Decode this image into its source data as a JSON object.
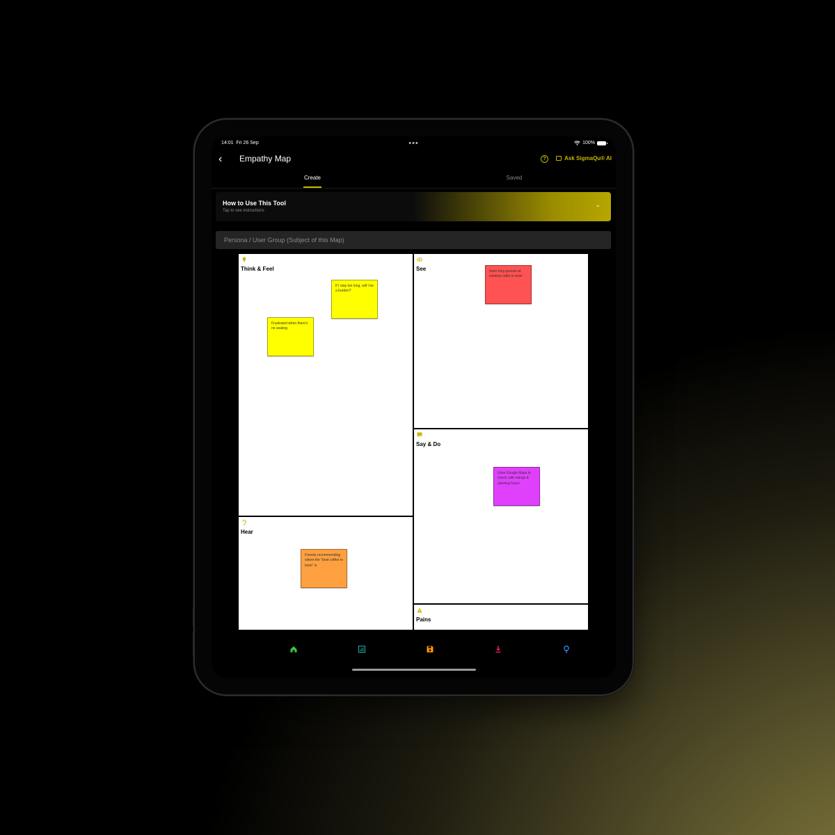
{
  "status_bar": {
    "time": "14:01",
    "date": "Fri 26 Sep",
    "battery": "100%"
  },
  "nav": {
    "back_glyph": "‹",
    "title": "Empathy Map",
    "help_glyph": "?",
    "ask_label": "Ask SigmaQu® AI"
  },
  "tabs": [
    {
      "label": "Create",
      "active": true
    },
    {
      "label": "Saved",
      "active": false
    }
  ],
  "how_to": {
    "title": "How to Use This Tool",
    "subtitle": "Tap to see instructions",
    "chevron_glyph": "⌄"
  },
  "persona": {
    "placeholder": "Persona / User Group (Subject of this Map)"
  },
  "quadrants": {
    "think_feel": {
      "label": "Think & Feel",
      "icon": "lightbulb-icon",
      "notes": [
        {
          "text": "If I stay too long, will I be a burden?",
          "color": "#ffff00"
        },
        {
          "text": "Frustrated when there's no seating",
          "color": "#ffff00"
        }
      ]
    },
    "see": {
      "label": "See",
      "icon": "eye-icon",
      "notes": [
        {
          "text": "Sees long queues at existing cafés in town",
          "color": "#ff5252"
        }
      ]
    },
    "hear": {
      "label": "Hear",
      "icon": "ear-icon",
      "notes": [
        {
          "text": "Friends recommending where the \"best coffee in town\" is",
          "color": "#ffa040"
        }
      ]
    },
    "say_do": {
      "label": "Say & Do",
      "icon": "speech-bubble-icon",
      "notes": [
        {
          "text": "Uses Google Maps to check café ratings & opening hours",
          "color": "#e040fb"
        }
      ]
    },
    "pains": {
      "label": "Pains",
      "icon": "warning-icon",
      "notes": []
    }
  },
  "bottom_bar": [
    {
      "icon": "home-icon",
      "color": "#3fbf3f"
    },
    {
      "icon": "chart-icon",
      "color": "#1aa89a"
    },
    {
      "icon": "save-icon",
      "color": "#ff9800"
    },
    {
      "icon": "download-icon",
      "color": "#ff1e56"
    },
    {
      "icon": "lightbulb-icon",
      "color": "#3f8cff"
    }
  ],
  "colors": {
    "accent": "#c9b800"
  }
}
